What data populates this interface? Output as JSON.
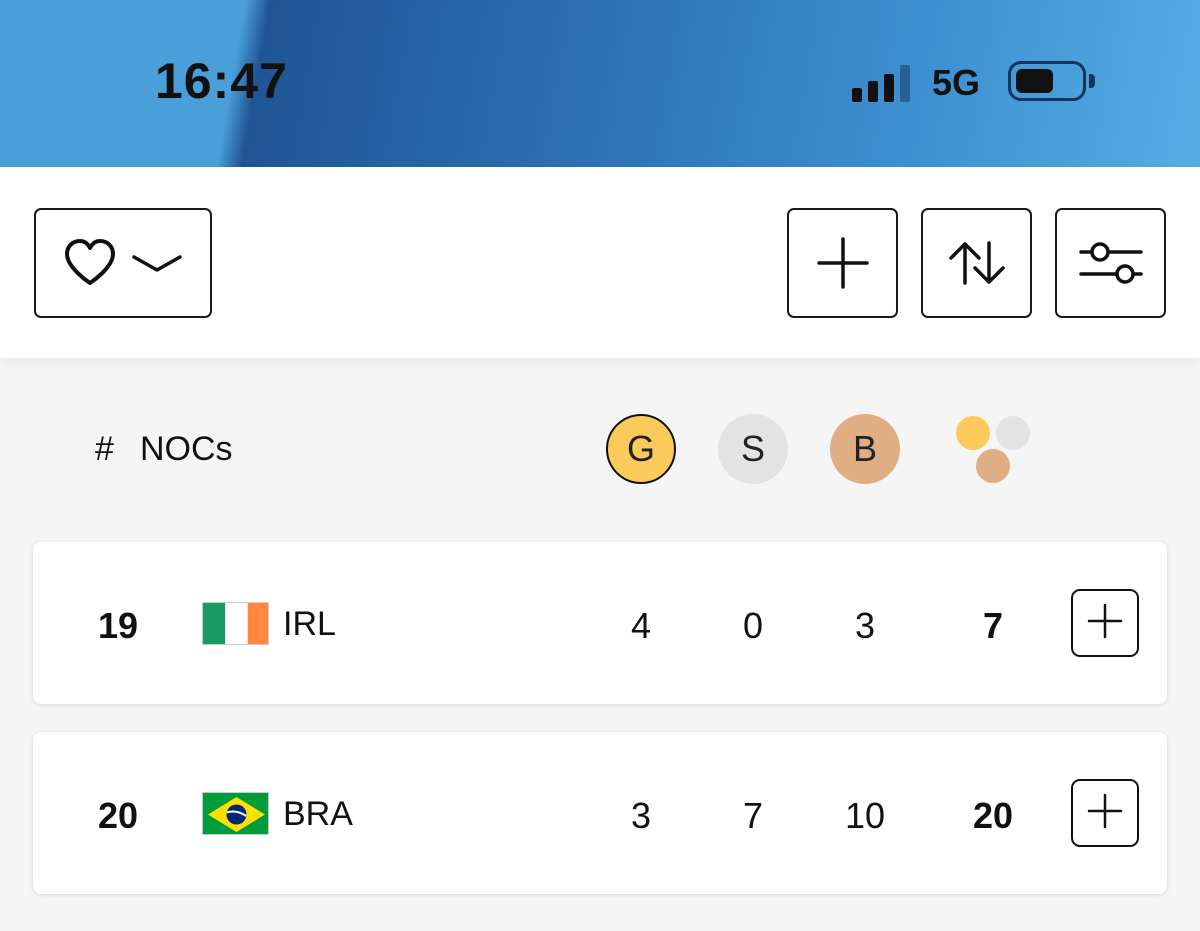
{
  "status_bar": {
    "time": "16:47",
    "network": "5G",
    "signal_bars_active": 3,
    "signal_bars_total": 4,
    "battery_level": 0.6
  },
  "toolbar": {
    "favorites_icon": "heart-icon",
    "dropdown_icon": "chevron-down-icon",
    "add_icon": "plus-icon",
    "sort_icon": "sort-arrows-icon",
    "filter_icon": "sliders-icon"
  },
  "table_header": {
    "rank_label": "#",
    "nocs_label": "NOCs",
    "gold_label": "G",
    "silver_label": "S",
    "bronze_label": "B",
    "total_icon": "medals-total-icon"
  },
  "colors": {
    "gold": "#fcc95b",
    "silver": "#e3e3e3",
    "bronze": "#dfae82"
  },
  "rows": [
    {
      "rank": "19",
      "flag": "ireland-flag",
      "noc": "IRL",
      "gold": "4",
      "silver": "0",
      "bronze": "3",
      "total": "7"
    },
    {
      "rank": "20",
      "flag": "brazil-flag",
      "noc": "BRA",
      "gold": "3",
      "silver": "7",
      "bronze": "10",
      "total": "20"
    }
  ]
}
